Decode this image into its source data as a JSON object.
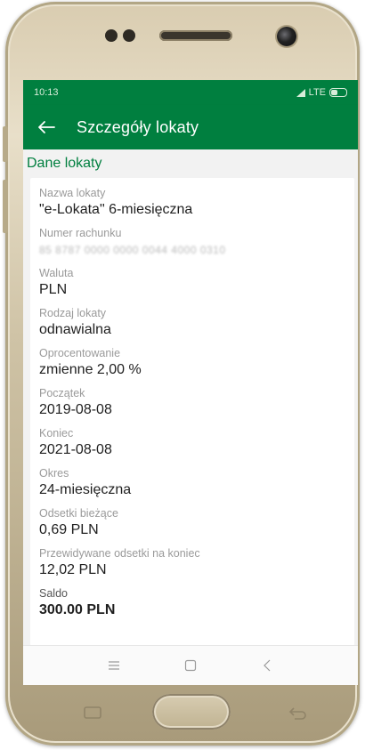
{
  "status_bar": {
    "time": "10:13",
    "network": "LTE"
  },
  "app_bar": {
    "title": "Szczegóły lokaty"
  },
  "section": {
    "title": "Dane lokaty"
  },
  "fields": [
    {
      "label": "Nazwa lokaty",
      "value": "\"e-Lokata\" 6-miesięczna"
    },
    {
      "label": "Numer rachunku",
      "value": "85 8787 0000 0000 0044 4000 0310"
    },
    {
      "label": "Waluta",
      "value": "PLN"
    },
    {
      "label": "Rodzaj lokaty",
      "value": "odnawialna"
    },
    {
      "label": "Oprocentowanie",
      "value": "zmienne 2,00 %"
    },
    {
      "label": "Początek",
      "value": "2019-08-08"
    },
    {
      "label": "Koniec",
      "value": "2021-08-08"
    },
    {
      "label": "Okres",
      "value": "24-miesięczna"
    },
    {
      "label": "Odsetki bieżące",
      "value": "0,69 PLN"
    },
    {
      "label": "Przewidywane odsetki na koniec",
      "value": "12,02 PLN"
    },
    {
      "label": "Saldo",
      "value": "300.00 PLN"
    }
  ],
  "colors": {
    "brand_green": "#007f3f",
    "label_gray": "#9a9a9a"
  },
  "icons": {
    "back": "arrow-left-icon",
    "recents": "recents-icon",
    "home": "home-icon",
    "back_nav": "back-nav-icon"
  }
}
